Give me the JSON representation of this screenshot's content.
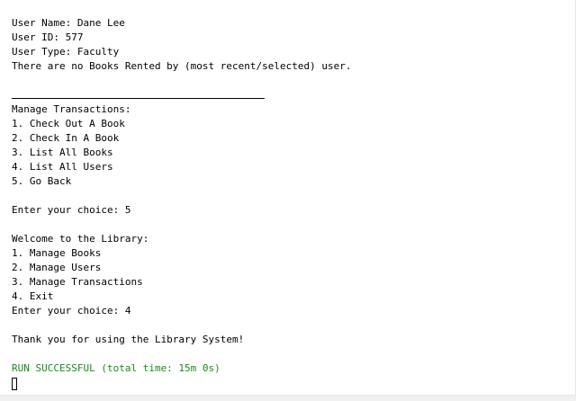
{
  "console": {
    "user_name_line": "User Name: Dane Lee",
    "user_id_line": "User ID: 577",
    "user_type_line": "User Type: Faculty",
    "no_books_line": "There are no Books Rented by (most recent/selected) user.",
    "manage_transactions_header": "Manage Transactions:",
    "transactions_menu": [
      "1. Check Out A Book",
      "2. Check In A Book",
      "3. List All Books",
      "4. List All Users",
      "5. Go Back"
    ],
    "choice_prompt_1": "Enter your choice: 5",
    "welcome_line": "Welcome to the Library:",
    "main_menu": [
      "1. Manage Books",
      "2. Manage Users",
      "3. Manage Transactions",
      "4. Exit"
    ],
    "choice_prompt_2": "Enter your choice: 4",
    "thank_you_line": "Thank you for using the Library System!",
    "run_status": "RUN SUCCESSFUL (total time: 15m 0s)"
  },
  "colors": {
    "background": "#ffffff",
    "text": "#000000",
    "success": "#1a8a1a"
  }
}
